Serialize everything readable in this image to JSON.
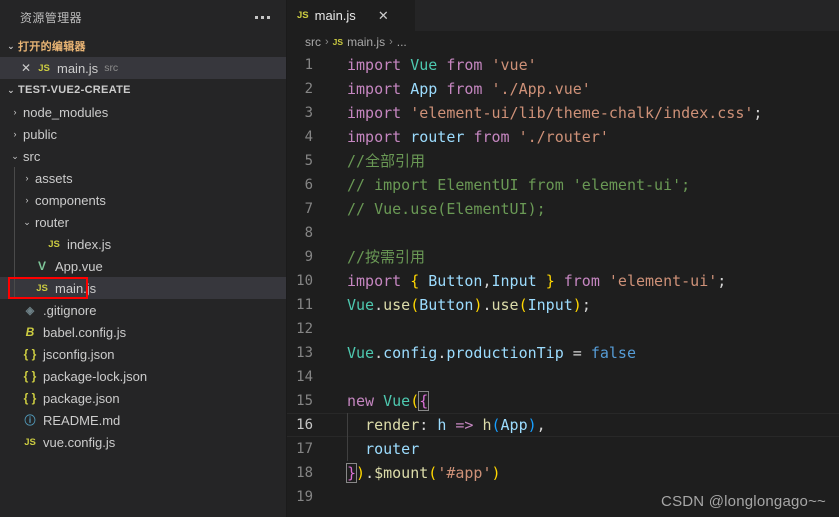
{
  "colors": {
    "sidebar_bg": "#252526",
    "editor_bg": "#1e1e1e",
    "selected_row": "#37373d",
    "annotation_red": "#ff0000",
    "accent_orange": "#e8b474",
    "js_icon": "#cbcb41",
    "comment_green": "#6a9955",
    "string_orange": "#ce9178",
    "keyword_purple": "#c586c0",
    "variable_blue": "#9cdcfe"
  },
  "sidebar": {
    "title": "资源管理器",
    "more_actions_icon": "ellipsis-icon",
    "open_editors": {
      "label": "打开的编辑器",
      "twisty": "⌄",
      "items": [
        {
          "close": "✕",
          "icon": "js-file-icon",
          "icon_text": "JS",
          "name": "main.js",
          "desc": "src",
          "selected": true
        }
      ]
    },
    "project": {
      "label": "TEST-VUE2-CREATE",
      "twisty": "⌄",
      "items": [
        {
          "depth": 0,
          "twisty": "›",
          "icon": "",
          "icon_text": "",
          "name": "node_modules",
          "type": "folder"
        },
        {
          "depth": 0,
          "twisty": "›",
          "icon": "",
          "icon_text": "",
          "name": "public",
          "type": "folder"
        },
        {
          "depth": 0,
          "twisty": "⌄",
          "icon": "",
          "icon_text": "",
          "name": "src",
          "type": "folder"
        },
        {
          "depth": 1,
          "twisty": "›",
          "icon": "",
          "icon_text": "",
          "name": "assets",
          "type": "folder"
        },
        {
          "depth": 1,
          "twisty": "›",
          "icon": "",
          "icon_text": "",
          "name": "components",
          "type": "folder"
        },
        {
          "depth": 1,
          "twisty": "⌄",
          "icon": "",
          "icon_text": "",
          "name": "router",
          "type": "folder"
        },
        {
          "depth": 2,
          "twisty": "",
          "icon": "js-file-icon",
          "icon_text": "JS",
          "name": "index.js",
          "type": "file"
        },
        {
          "depth": 1,
          "twisty": "",
          "icon": "vue-file-icon",
          "icon_text": "V",
          "name": "App.vue",
          "type": "file"
        },
        {
          "depth": 1,
          "twisty": "",
          "icon": "js-file-icon",
          "icon_text": "JS",
          "name": "main.js",
          "type": "file",
          "selected": true,
          "annotated": true
        },
        {
          "depth": 0,
          "twisty": "",
          "icon": "git-file-icon",
          "icon_text": "◈",
          "name": ".gitignore",
          "type": "file"
        },
        {
          "depth": 0,
          "twisty": "",
          "icon": "babel-file-icon",
          "icon_text": "B",
          "name": "babel.config.js",
          "type": "file"
        },
        {
          "depth": 0,
          "twisty": "",
          "icon": "json-file-icon",
          "icon_text": "{ }",
          "name": "jsconfig.json",
          "type": "file"
        },
        {
          "depth": 0,
          "twisty": "",
          "icon": "json-file-icon",
          "icon_text": "{ }",
          "name": "package-lock.json",
          "type": "file"
        },
        {
          "depth": 0,
          "twisty": "",
          "icon": "json-file-icon",
          "icon_text": "{ }",
          "name": "package.json",
          "type": "file"
        },
        {
          "depth": 0,
          "twisty": "",
          "icon": "markdown-file-icon",
          "icon_text": "ⓘ",
          "name": "README.md",
          "type": "file"
        },
        {
          "depth": 0,
          "twisty": "",
          "icon": "js-file-icon",
          "icon_text": "JS",
          "name": "vue.config.js",
          "type": "file"
        }
      ]
    }
  },
  "editor": {
    "tab": {
      "icon_text": "JS",
      "label": "main.js",
      "close_icon": "✕"
    },
    "breadcrumb": {
      "root": "src",
      "sep": "›",
      "file_icon": "JS",
      "file": "main.js",
      "tail": "..."
    },
    "watermark": "CSDN @longlongago~~",
    "active_line": 16,
    "lines": [
      {
        "n": 1,
        "tokens": [
          {
            "t": "import",
            "c": "kw"
          },
          {
            "t": " ",
            "c": "pun"
          },
          {
            "t": "Vue",
            "c": "cls"
          },
          {
            "t": " ",
            "c": "pun"
          },
          {
            "t": "from",
            "c": "kw"
          },
          {
            "t": " ",
            "c": "pun"
          },
          {
            "t": "'vue'",
            "c": "str"
          }
        ]
      },
      {
        "n": 2,
        "tokens": [
          {
            "t": "import",
            "c": "kw"
          },
          {
            "t": " ",
            "c": "pun"
          },
          {
            "t": "App",
            "c": "var"
          },
          {
            "t": " ",
            "c": "pun"
          },
          {
            "t": "from",
            "c": "kw"
          },
          {
            "t": " ",
            "c": "pun"
          },
          {
            "t": "'./App.vue'",
            "c": "str"
          }
        ]
      },
      {
        "n": 3,
        "tokens": [
          {
            "t": "import",
            "c": "kw"
          },
          {
            "t": " ",
            "c": "pun"
          },
          {
            "t": "'element-ui/lib/theme-chalk/index.css'",
            "c": "str"
          },
          {
            "t": ";",
            "c": "pun"
          }
        ]
      },
      {
        "n": 4,
        "tokens": [
          {
            "t": "import",
            "c": "kw"
          },
          {
            "t": " ",
            "c": "pun"
          },
          {
            "t": "router",
            "c": "var"
          },
          {
            "t": " ",
            "c": "pun"
          },
          {
            "t": "from",
            "c": "kw"
          },
          {
            "t": " ",
            "c": "pun"
          },
          {
            "t": "'./router'",
            "c": "str"
          }
        ]
      },
      {
        "n": 5,
        "tokens": [
          {
            "t": "//全部引用",
            "c": "cmt"
          }
        ]
      },
      {
        "n": 6,
        "tokens": [
          {
            "t": "// import ElementUI from 'element-ui';",
            "c": "cmt"
          }
        ]
      },
      {
        "n": 7,
        "tokens": [
          {
            "t": "// Vue.use(ElementUI);",
            "c": "cmt"
          }
        ]
      },
      {
        "n": 8,
        "tokens": []
      },
      {
        "n": 9,
        "tokens": [
          {
            "t": "//按需引用",
            "c": "cmt"
          }
        ]
      },
      {
        "n": 10,
        "tokens": [
          {
            "t": "import",
            "c": "kw"
          },
          {
            "t": " ",
            "c": "pun"
          },
          {
            "t": "{",
            "c": "br-y"
          },
          {
            "t": " ",
            "c": "pun"
          },
          {
            "t": "Button",
            "c": "var"
          },
          {
            "t": ",",
            "c": "pun"
          },
          {
            "t": "Input",
            "c": "var"
          },
          {
            "t": " ",
            "c": "pun"
          },
          {
            "t": "}",
            "c": "br-y"
          },
          {
            "t": " ",
            "c": "pun"
          },
          {
            "t": "from",
            "c": "kw"
          },
          {
            "t": " ",
            "c": "pun"
          },
          {
            "t": "'element-ui'",
            "c": "str"
          },
          {
            "t": ";",
            "c": "pun"
          }
        ]
      },
      {
        "n": 11,
        "tokens": [
          {
            "t": "Vue",
            "c": "cls"
          },
          {
            "t": ".",
            "c": "pun"
          },
          {
            "t": "use",
            "c": "fn"
          },
          {
            "t": "(",
            "c": "br-y"
          },
          {
            "t": "Button",
            "c": "var"
          },
          {
            "t": ")",
            "c": "br-y"
          },
          {
            "t": ".",
            "c": "pun"
          },
          {
            "t": "use",
            "c": "fn"
          },
          {
            "t": "(",
            "c": "br-y"
          },
          {
            "t": "Input",
            "c": "var"
          },
          {
            "t": ")",
            "c": "br-y"
          },
          {
            "t": ";",
            "c": "pun"
          }
        ]
      },
      {
        "n": 12,
        "tokens": []
      },
      {
        "n": 13,
        "tokens": [
          {
            "t": "Vue",
            "c": "cls"
          },
          {
            "t": ".",
            "c": "pun"
          },
          {
            "t": "config",
            "c": "prop"
          },
          {
            "t": ".",
            "c": "pun"
          },
          {
            "t": "productionTip",
            "c": "prop"
          },
          {
            "t": " ",
            "c": "pun"
          },
          {
            "t": "=",
            "c": "pun"
          },
          {
            "t": " ",
            "c": "pun"
          },
          {
            "t": "false",
            "c": "kwb"
          }
        ]
      },
      {
        "n": 14,
        "tokens": []
      },
      {
        "n": 15,
        "tokens": [
          {
            "t": "new",
            "c": "kw"
          },
          {
            "t": " ",
            "c": "pun"
          },
          {
            "t": "Vue",
            "c": "cls"
          },
          {
            "t": "(",
            "c": "br-y"
          },
          {
            "t": "{",
            "c": "br-p brace-hl"
          }
        ]
      },
      {
        "n": 16,
        "tokens": [
          {
            "t": "  ",
            "c": "pun"
          },
          {
            "t": "render",
            "c": "fn"
          },
          {
            "t": ":",
            "c": "pun"
          },
          {
            "t": " ",
            "c": "pun"
          },
          {
            "t": "h",
            "c": "var"
          },
          {
            "t": " ",
            "c": "pun"
          },
          {
            "t": "=>",
            "c": "kw"
          },
          {
            "t": " ",
            "c": "pun"
          },
          {
            "t": "h",
            "c": "fn"
          },
          {
            "t": "(",
            "c": "br-b"
          },
          {
            "t": "App",
            "c": "var"
          },
          {
            "t": ")",
            "c": "br-b"
          },
          {
            "t": ",",
            "c": "pun"
          }
        ],
        "indent_guide": true
      },
      {
        "n": 17,
        "tokens": [
          {
            "t": "  ",
            "c": "pun"
          },
          {
            "t": "router",
            "c": "var"
          }
        ],
        "indent_guide": true
      },
      {
        "n": 18,
        "tokens": [
          {
            "t": "}",
            "c": "br-p brace-hl"
          },
          {
            "t": ")",
            "c": "br-y"
          },
          {
            "t": ".",
            "c": "pun"
          },
          {
            "t": "$mount",
            "c": "fn"
          },
          {
            "t": "(",
            "c": "br-y"
          },
          {
            "t": "'#app'",
            "c": "str"
          },
          {
            "t": ")",
            "c": "br-y"
          }
        ]
      },
      {
        "n": 19,
        "tokens": []
      }
    ]
  }
}
